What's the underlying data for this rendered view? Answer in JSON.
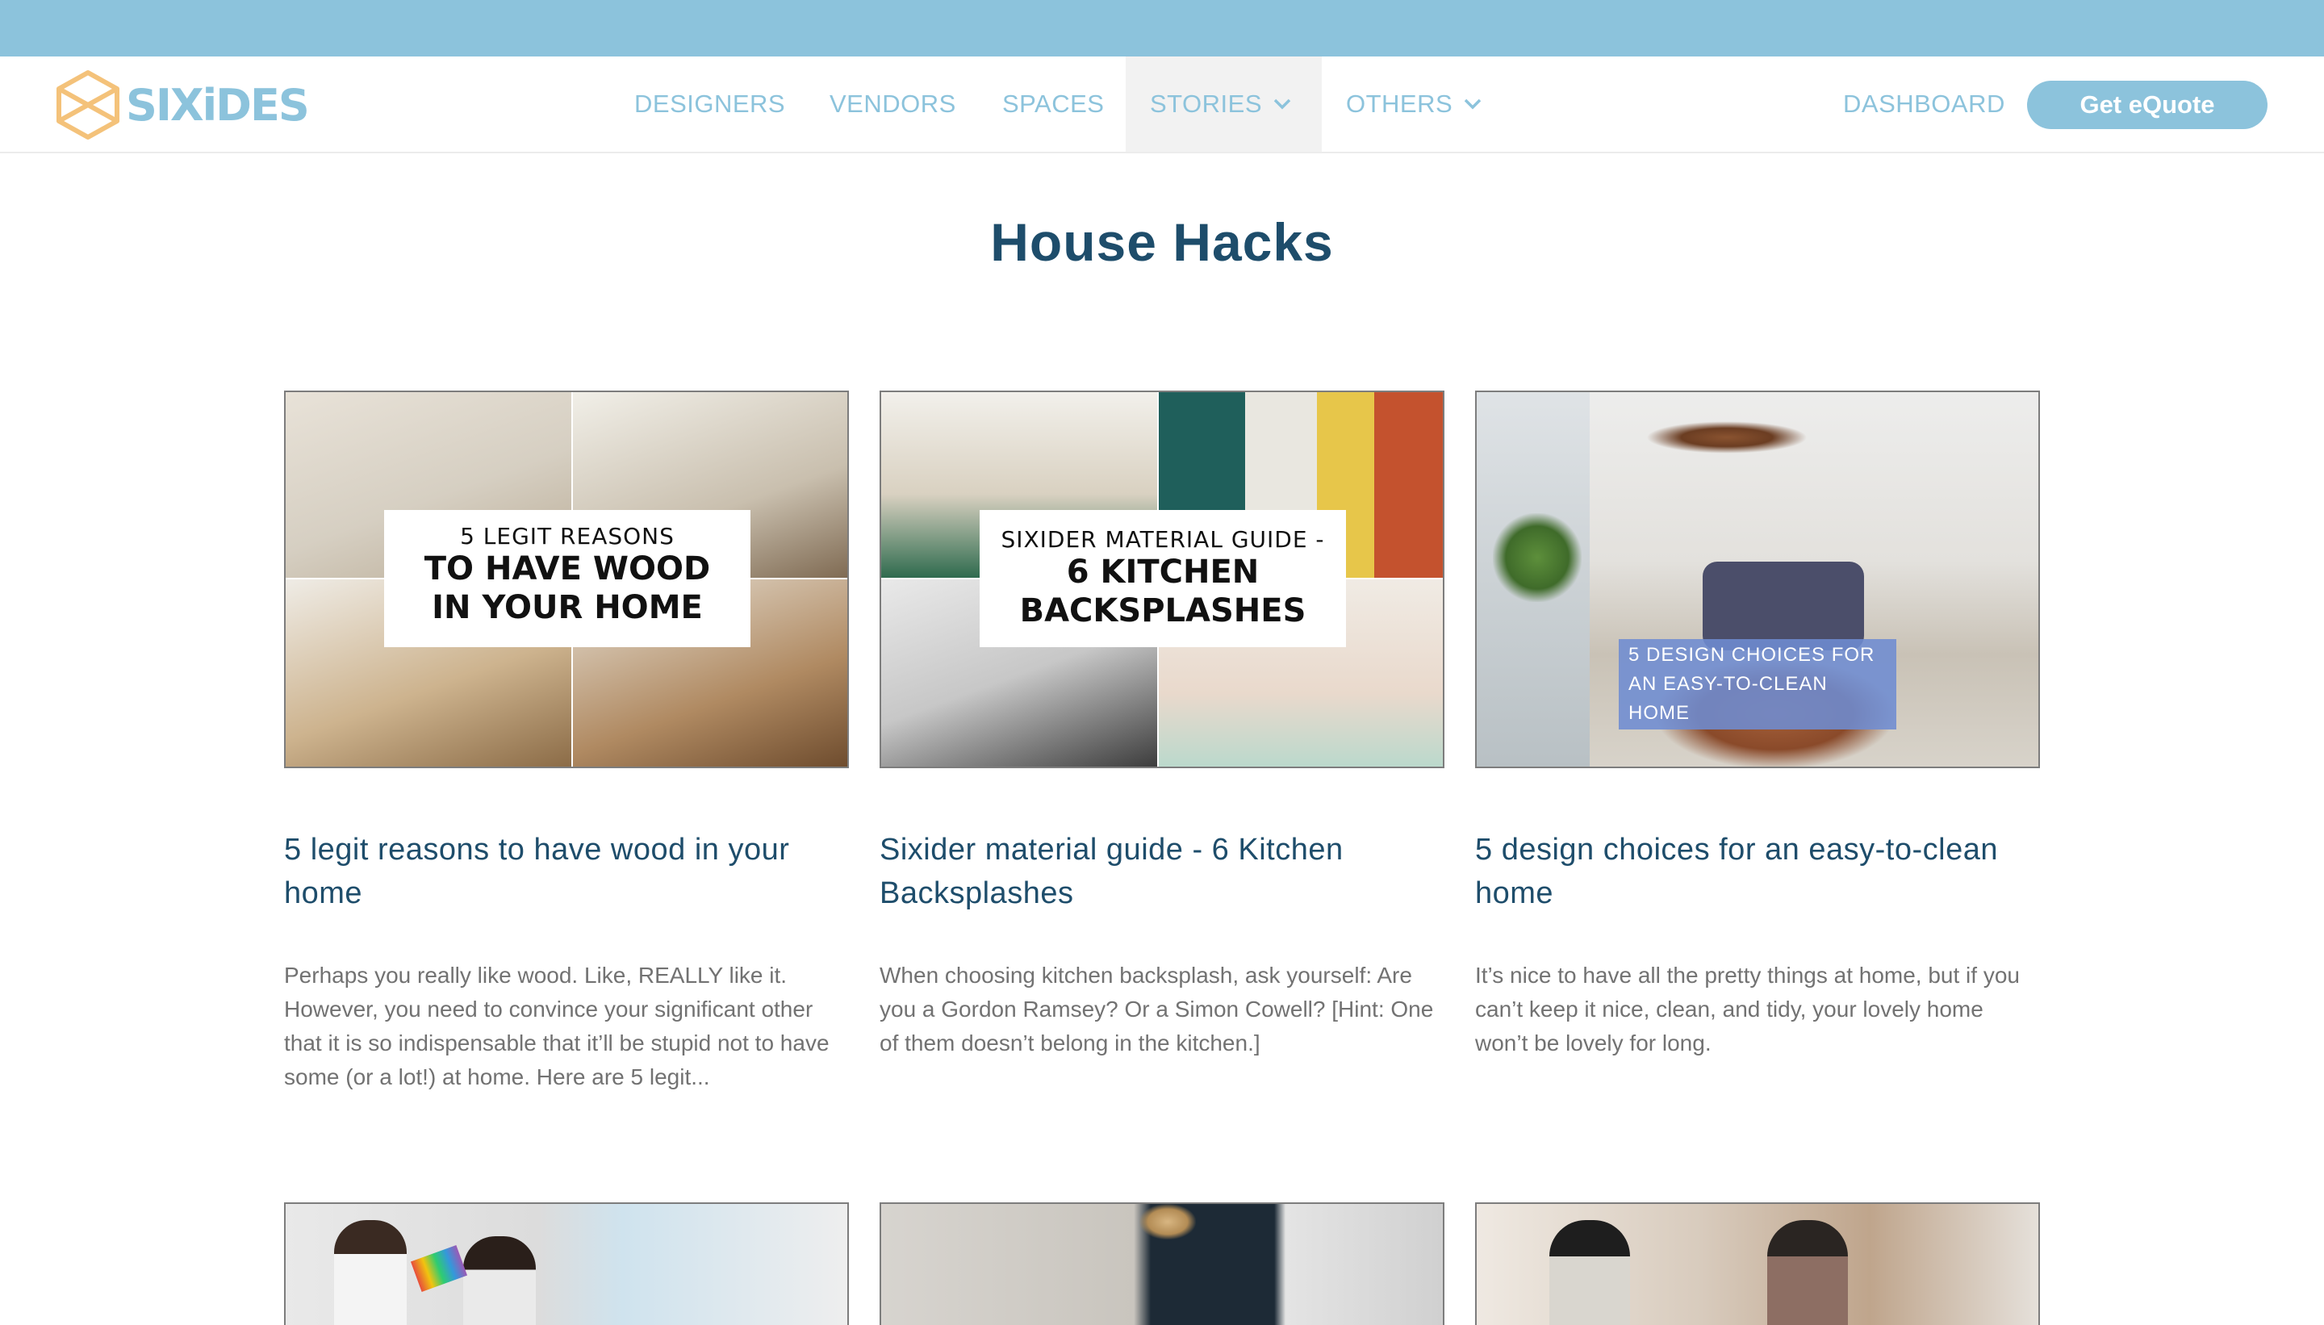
{
  "brand": {
    "name": "SIXiDES"
  },
  "nav": {
    "items": [
      {
        "label": "DESIGNERS"
      },
      {
        "label": "VENDORS"
      },
      {
        "label": "SPACES"
      },
      {
        "label": "STORIES"
      },
      {
        "label": "OTHERS"
      }
    ],
    "dashboard": "DASHBOARD",
    "cta": "Get eQuote"
  },
  "page": {
    "title": "House Hacks"
  },
  "cards": [
    {
      "image_caption": [
        "5 LEGIT REASONS",
        "TO HAVE WOOD",
        "IN YOUR HOME"
      ],
      "title": "5 legit reasons to have wood in your home",
      "excerpt": "Perhaps you really like wood. Like, REALLY like it. However, you need to convince your significant other that it is so indispensable that it’ll be stupid not to have some (or a lot!) at home. Here are 5 legit..."
    },
    {
      "image_caption": [
        "SIXIDER MATERIAL GUIDE -",
        "6 KITCHEN",
        "BACKSPLASHES"
      ],
      "title": "Sixider material guide - 6 Kitchen Backsplashes",
      "excerpt": "When choosing kitchen backsplash, ask yourself: Are you a Gordon Ramsey? Or a Simon Cowell? [Hint: One of them doesn’t belong in the kitchen.]"
    },
    {
      "image_caption": [
        "5 DESIGN CHOICES FOR",
        "AN EASY-TO-CLEAN HOME"
      ],
      "title": "5 design choices for an easy-to-clean home",
      "excerpt": "It’s nice to have all the pretty things at home, but if you can’t keep it nice, clean, and tidy, your lovely home won’t be lovely for long."
    }
  ],
  "colors": {
    "topbar": "#8cc3dc",
    "accent": "#8cc3dc",
    "heading": "#1e4d6b",
    "logo_hex": "#f4c27a"
  }
}
